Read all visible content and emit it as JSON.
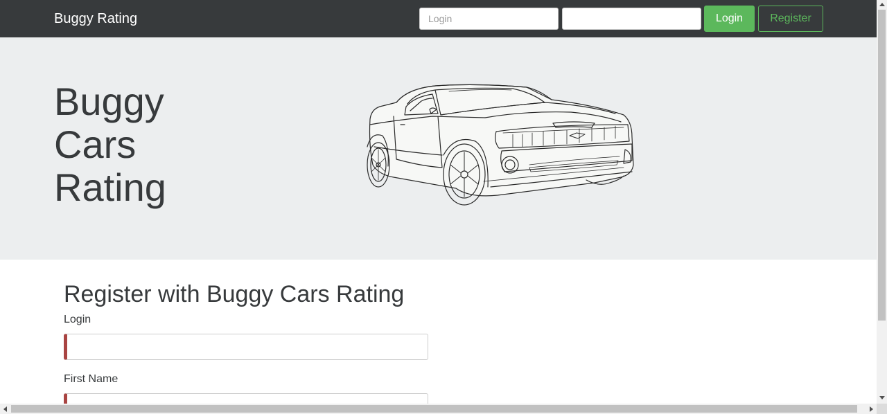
{
  "navbar": {
    "brand": "Buggy Rating",
    "login_placeholder": "Login",
    "password_placeholder": "",
    "login_button": "Login",
    "register_button": "Register"
  },
  "hero": {
    "title_lines": [
      "Buggy",
      "Cars",
      "Rating"
    ],
    "image": "car-line-drawing"
  },
  "register_form": {
    "heading": "Register with Buggy Cars Rating",
    "fields": [
      {
        "label": "Login",
        "value": ""
      },
      {
        "label": "First Name",
        "value": ""
      }
    ]
  },
  "colors": {
    "navbar_bg": "#373a3c",
    "hero_bg": "#eceeef",
    "success": "#5cb85c",
    "invalid_marker": "#a94442"
  }
}
